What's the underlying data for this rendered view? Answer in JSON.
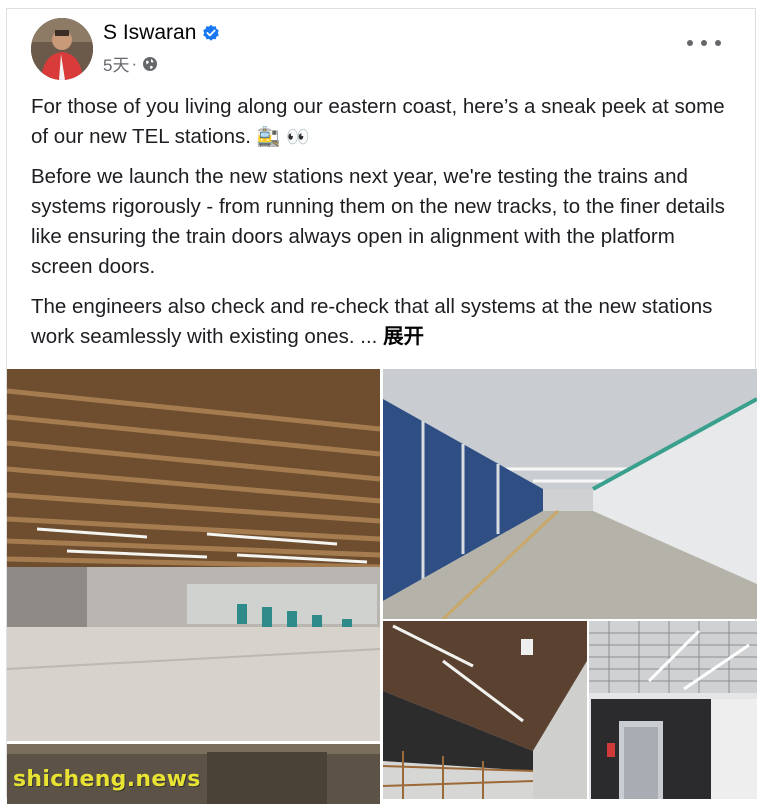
{
  "post": {
    "author": "S Iswaran",
    "time": "5天",
    "meta_separator": "·",
    "paragraphs": [
      "For those of you living along our eastern coast, here’s a sneak peek at some of our new TEL stations.",
      "Before we launch the new stations next year, we're testing the trains and systems rigorously - from running them on the new tracks, to the finer details like ensuring the train doors always open in alignment with the platform screen doors.",
      "The engineers also check and re-check that all systems at the new stations work seamlessly with existing ones. ..."
    ],
    "emoji_1": "🚉 👀",
    "expand_label": "展开"
  },
  "watermark": "shicheng.news",
  "icons": [
    "verified-icon",
    "globe-icon",
    "more-options-icon"
  ],
  "colors": {
    "verified_blue": "#1877f2",
    "meta_gray": "#65676b",
    "watermark_yellow": "#e8e233"
  }
}
